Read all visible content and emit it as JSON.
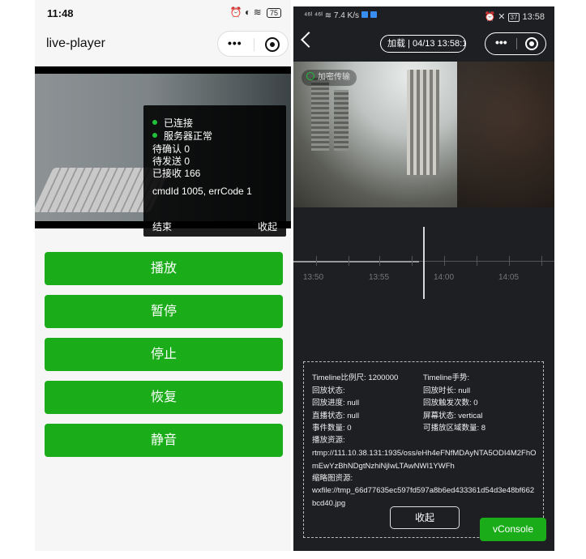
{
  "left": {
    "status": {
      "time": "11:48",
      "signal": "4G",
      "icons": "⏰ ◐ ≋",
      "battery": "75"
    },
    "nav": {
      "title": "live-player",
      "more": "•••"
    },
    "overlay": {
      "lines": [
        "已连接",
        "服务器正常",
        "待确认 0",
        "待发送 0",
        "已接收 166"
      ],
      "cmd": "cmdId 1005, errCode 1",
      "end_label": "结束",
      "collapse_label": "收起"
    },
    "buttons": [
      "播放",
      "暂停",
      "停止",
      "恢复",
      "静音"
    ]
  },
  "right": {
    "status": {
      "left": "⁴⁶ᴵ ⁴⁶ᴵ ≋ 7.4 K/s",
      "time": "13:58",
      "battery": "37",
      "icons": "⏰ ✕"
    },
    "nav": {
      "time_pill": "加载 | 04/13 13:58:19",
      "more": "•••"
    },
    "video": {
      "badge": "加密传输"
    },
    "timeline": {
      "labels": [
        "13:50",
        "13:55",
        "14:00",
        "14:05"
      ]
    },
    "panel": {
      "col1": [
        "Timeline比例尺: 1200000",
        "回放状态:",
        "回放进度: null",
        "直播状态: null",
        "事件数量: 0"
      ],
      "col2": [
        "Timeline手势:",
        "回放时长: null",
        "回放触发次数: 0",
        "屏幕状态: vertical",
        "可播放区域数量: 8"
      ],
      "stream_label": "播放资源:",
      "stream_url": "rtmp://111.10.38.131:1935/oss/eHh4eFNfMDAyNTA5ODI4M2FhOmEwYzBhNDgtNzhiNjIwLTAwNWI1YWFh",
      "thumb_label": "缩略图资源:",
      "thumb_url": "wxfile://tmp_66d77635ec597fd597a8b6ed433361d54d3e48bf662bcd40.jpg",
      "close_label": "收起"
    },
    "vconsole_label": "vConsole"
  }
}
